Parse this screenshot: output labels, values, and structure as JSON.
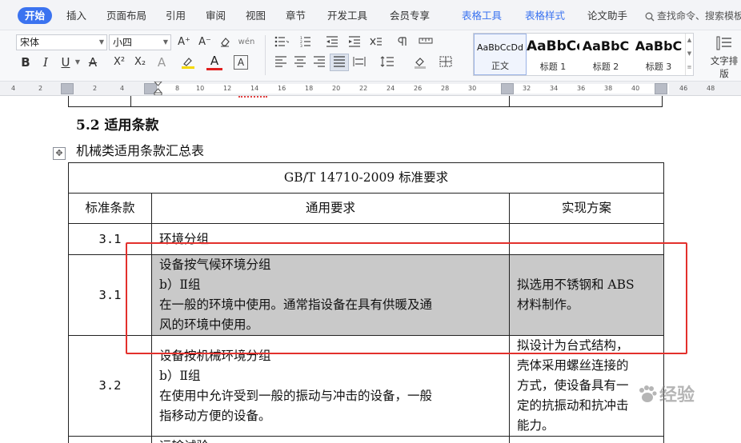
{
  "menubar": {
    "tabs": [
      {
        "label": "开始",
        "active": true
      },
      {
        "label": "插入"
      },
      {
        "label": "页面布局"
      },
      {
        "label": "引用"
      },
      {
        "label": "审阅"
      },
      {
        "label": "视图"
      },
      {
        "label": "章节"
      },
      {
        "label": "开发工具"
      },
      {
        "label": "会员专享"
      },
      {
        "label": "表格工具",
        "contextual": true
      },
      {
        "label": "表格样式",
        "contextual": true
      },
      {
        "label": "论文助手"
      }
    ],
    "search_label": "查找命令、搜索模板",
    "accent_color": "#3b73f0"
  },
  "toolbar": {
    "font_name": "宋体",
    "font_size": "小四",
    "icons": {
      "grow_font": "A⁺",
      "shrink_font": "A⁻",
      "bold": "B",
      "italic": "I",
      "underline": "U",
      "strikethrough": "A",
      "superscript": "X²",
      "subscript": "X₂",
      "text_effect": "A",
      "font_color": "A",
      "char_border": "A",
      "pinyin": "wén"
    },
    "styles": [
      {
        "sample": "AaBbCcDd",
        "name": "正文",
        "selected": true
      },
      {
        "sample": "AaBbCc",
        "name": "标题 1"
      },
      {
        "sample": "AaBbC",
        "name": "标题 2"
      },
      {
        "sample": "AaBbC",
        "name": "标题 3"
      }
    ],
    "text_layout_label": "文字排版"
  },
  "ruler": {
    "ticks": [
      "4",
      "2",
      "2",
      "4",
      "8",
      "10",
      "12",
      "14",
      "16",
      "18",
      "20",
      "22",
      "24",
      "26",
      "28",
      "30",
      "32",
      "34",
      "36",
      "38",
      "40",
      "42",
      "44",
      "46",
      "48"
    ]
  },
  "document": {
    "heading": "5.2 适用条款",
    "caption": "机械类适用条款汇总表",
    "table": {
      "title": "GB/T 14710-2009 标准要求",
      "headers": [
        "标准条款",
        "通用要求",
        "实现方案"
      ],
      "rows": [
        {
          "clause": "3.1",
          "requirement": [
            "环境分组"
          ],
          "solution": [
            ""
          ]
        },
        {
          "clause": "3.1",
          "requirement": [
            "设备按气候环境分组",
            "b）Ⅱ组",
            "在一般的环境中使用。通常指设备在具有供暖及通",
            "风的环境中使用。"
          ],
          "solution": [
            "拟选用不锈钢和 ABS",
            "材料制作。"
          ],
          "highlighted": true
        },
        {
          "clause": "3.2",
          "requirement": [
            "设备按机械环境分组",
            "b）Ⅱ组",
            "在使用中允许受到一般的振动与冲击的设备，一般",
            "指移动方便的设备。"
          ],
          "solution": [
            "拟设计为台式结构，",
            "壳体采用螺丝连接的",
            "方式，使设备具有一",
            "定的抗振动和抗冲击",
            "能力。"
          ]
        },
        {
          "clause": "",
          "requirement": [
            "运输试验"
          ],
          "solution": [
            ""
          ]
        }
      ]
    },
    "highlight_color": "#c9c9c9",
    "annotation_color": "#e3302c",
    "watermark_text": "经验"
  }
}
